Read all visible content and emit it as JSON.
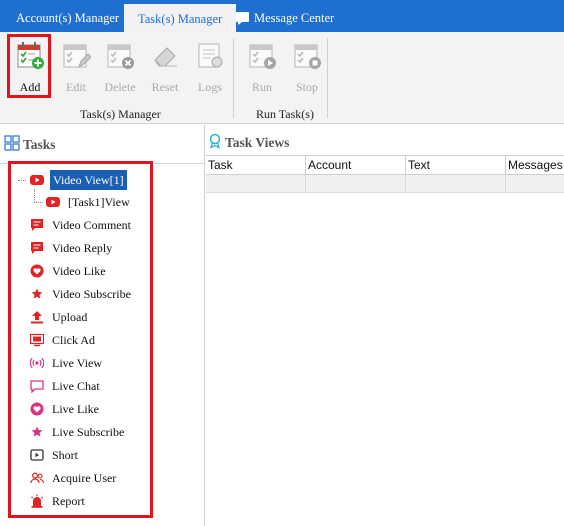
{
  "tabs": [
    {
      "label": "Account(s) Manager"
    },
    {
      "label": "Task(s) Manager"
    },
    {
      "label": "Message Center"
    }
  ],
  "ribbon": {
    "buttons": [
      {
        "label": "Add",
        "icon": "add-task-icon",
        "enabled": true
      },
      {
        "label": "Edit",
        "icon": "edit-task-icon",
        "enabled": false
      },
      {
        "label": "Delete",
        "icon": "delete-task-icon",
        "enabled": false
      },
      {
        "label": "Reset",
        "icon": "reset-eraser-icon",
        "enabled": false
      },
      {
        "label": "Logs",
        "icon": "logs-icon",
        "enabled": false
      },
      {
        "label": "Run",
        "icon": "run-task-icon",
        "enabled": false
      },
      {
        "label": "Stop",
        "icon": "stop-task-icon",
        "enabled": false
      }
    ],
    "groups": [
      {
        "label": "Task(s) Manager"
      },
      {
        "label": "Run Task(s)"
      }
    ]
  },
  "tasks_pane": {
    "title": "Tasks",
    "items": [
      {
        "label": "Video View[1]",
        "icon": "youtube-icon",
        "selected": true
      },
      {
        "label": "[Task1]View",
        "icon": "youtube-icon",
        "selected": false
      },
      {
        "label": "Video Comment",
        "icon": "comment-icon",
        "selected": false
      },
      {
        "label": "Video Reply",
        "icon": "reply-icon",
        "selected": false
      },
      {
        "label": "Video Like",
        "icon": "heart-icon",
        "selected": false
      },
      {
        "label": "Video Subscribe",
        "icon": "star-icon",
        "selected": false
      },
      {
        "label": "Upload",
        "icon": "upload-icon",
        "selected": false
      },
      {
        "label": "Click Ad",
        "icon": "ad-icon",
        "selected": false
      },
      {
        "label": "Live View",
        "icon": "broadcast-icon",
        "selected": false
      },
      {
        "label": "Live Chat",
        "icon": "chat-icon",
        "selected": false
      },
      {
        "label": "Live Like",
        "icon": "heart-icon",
        "selected": false
      },
      {
        "label": "Live Subscribe",
        "icon": "star-icon",
        "selected": false
      },
      {
        "label": "Short",
        "icon": "shorts-play-icon",
        "selected": false
      },
      {
        "label": "Acquire User",
        "icon": "users-icon",
        "selected": false
      },
      {
        "label": "Report",
        "icon": "alarm-icon",
        "selected": false
      }
    ]
  },
  "task_views": {
    "title": "Task Views",
    "columns": [
      "Task",
      "Account",
      "Text",
      "Messages"
    ]
  },
  "colors": {
    "tab_bar": "#1e6fcf",
    "highlight_box": "#e0141d",
    "selection": "#1a5fb4",
    "icon_red": "#e02424"
  }
}
